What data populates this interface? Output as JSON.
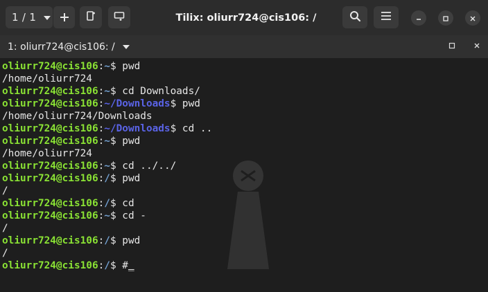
{
  "header": {
    "session_label": "1 / 1",
    "title": "Tilix: oliurr724@cis106: /"
  },
  "terminal_tab": {
    "label": "1: oliurr724@cis106: /"
  },
  "terminal": {
    "lines": [
      {
        "user": "oliurr724@cis106",
        "path": "~",
        "cmd": "$ pwd"
      },
      {
        "out": "/home/oliurr724"
      },
      {
        "user": "oliurr724@cis106",
        "path": "~",
        "cmd": "$ cd Downloads/"
      },
      {
        "user": "oliurr724@cis106",
        "path": "~/Downloads",
        "cmd": "$ pwd"
      },
      {
        "out": "/home/oliurr724/Downloads"
      },
      {
        "user": "oliurr724@cis106",
        "path": "~/Downloads",
        "cmd": "$ cd .."
      },
      {
        "user": "oliurr724@cis106",
        "path": "~",
        "cmd": "$ pwd"
      },
      {
        "out": "/home/oliurr724"
      },
      {
        "user": "oliurr724@cis106",
        "path": "~",
        "cmd": "$ cd ../../"
      },
      {
        "user": "oliurr724@cis106",
        "path": "/",
        "cmd": "$ pwd"
      },
      {
        "out": "/"
      },
      {
        "user": "oliurr724@cis106",
        "path": "/",
        "cmd": "$ cd"
      },
      {
        "user": "oliurr724@cis106",
        "path": "~",
        "cmd": "$ cd -"
      },
      {
        "out": "/"
      },
      {
        "user": "oliurr724@cis106",
        "path": "/",
        "cmd": "$ pwd"
      },
      {
        "out": "/"
      },
      {
        "user": "oliurr724@cis106",
        "path": "/",
        "cmd": "$ #",
        "cursor": "_"
      }
    ]
  },
  "colors": {
    "user": "#8ae234",
    "path": "#729fcf",
    "downloads_path": "#5a63e6",
    "background": "#1e1e1e"
  }
}
